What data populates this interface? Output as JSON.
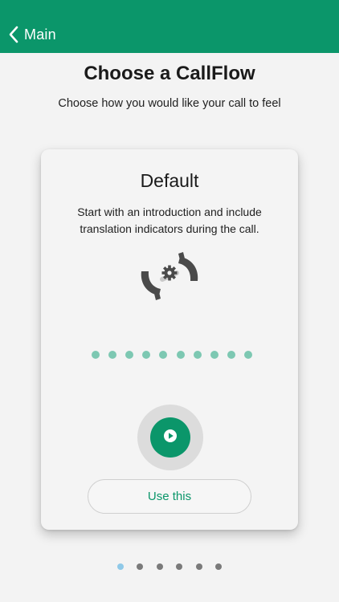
{
  "nav": {
    "back_label": "Main"
  },
  "header": {
    "title": "Choose a CallFlow",
    "subtitle": "Choose how you would like your call to feel"
  },
  "card": {
    "title": "Default",
    "description": "Start with an introduction and include translation indicators during the call.",
    "icon": "callflow-settings-icon",
    "step_dot_count": 10,
    "play_icon": "play-icon",
    "use_button_label": "Use this"
  },
  "pager": {
    "page_count": 6,
    "current_page": 1
  },
  "colors": {
    "accent": "#0b966a",
    "step_dot": "#7dc8b2",
    "page_dot_active": "#8fc9e8",
    "page_dot_inactive": "#7a7a7a"
  }
}
